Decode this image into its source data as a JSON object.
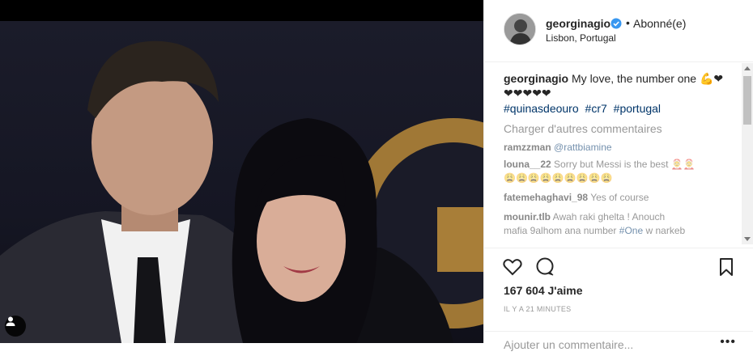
{
  "post": {
    "username": "georginagio",
    "follow_state": "Abonné(e)",
    "separator": "•",
    "location": "Lisbon, Portugal",
    "caption_text": "My love, the number one 💪❤",
    "caption_hearts": "❤❤❤❤❤",
    "hashtags": [
      "#quinasdeouro",
      "#cr7",
      "#portugal"
    ],
    "load_more_label": "Charger d'autres commentaires",
    "comments": [
      {
        "user": "ramzzman",
        "text": "",
        "mention": "@rattbiamine"
      },
      {
        "user": "louna__22",
        "text": "Sorry but Messi is the best 🤶🤶",
        "mention": ""
      },
      {
        "user": "",
        "text": "😩😩😩😩😩😩😩😩😩",
        "mention": ""
      },
      {
        "user": "fatemehaghavi_98",
        "text": "Yes of course",
        "mention": ""
      },
      {
        "user": "mounir.tlb",
        "text": "Awah raki ghelta ! Anouch",
        "mention": ""
      },
      {
        "user": "",
        "text": "mafia 9alhom ana number",
        "mention": "#One",
        "text_after": "w narkeb"
      }
    ],
    "likes": "167 604 J'aime",
    "time_ago": "Il y a 21 minutes",
    "add_comment_placeholder": "Ajouter un commentaire...",
    "more_options": "•••"
  },
  "icons": {
    "tag": "user-tag-icon",
    "verified": "verified-badge-icon",
    "like": "heart-outline-icon",
    "comment": "comment-bubble-icon",
    "save": "bookmark-icon"
  },
  "colors": {
    "verified_blue": "#3897f0",
    "hashtag_blue": "#003569",
    "muted_gray": "#999999"
  }
}
